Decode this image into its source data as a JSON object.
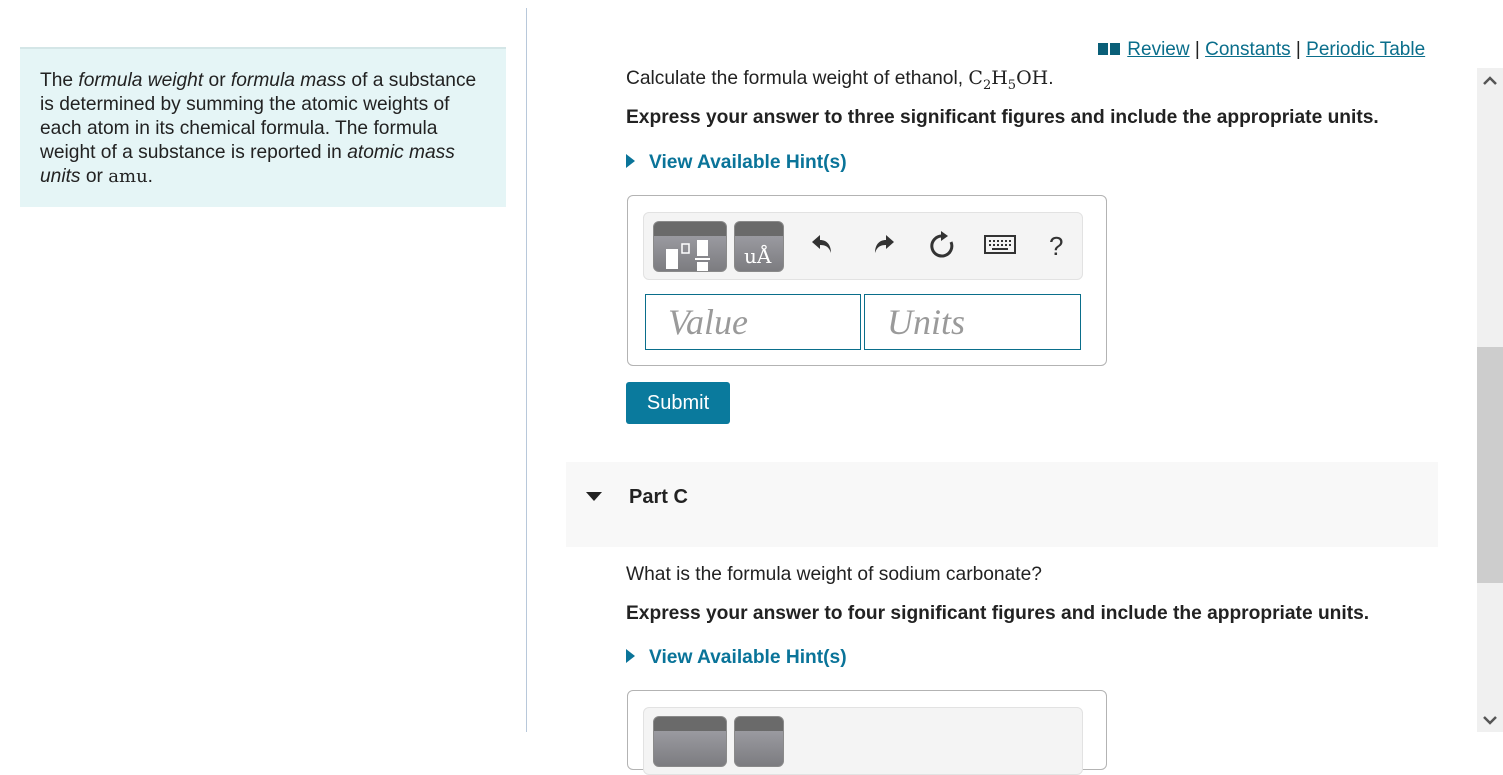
{
  "intro": {
    "segments": [
      {
        "text": "The ",
        "style": "normal"
      },
      {
        "text": "formula weight",
        "style": "italic"
      },
      {
        "text": " or ",
        "style": "normal"
      },
      {
        "text": "formula mass",
        "style": "italic"
      },
      {
        "text": " of a substance is determined by summing the atomic weights of each atom in its chemical formula. The formula weight of a substance is reported in ",
        "style": "normal"
      },
      {
        "text": "atomic mass units",
        "style": "italic"
      },
      {
        "text": " or ",
        "style": "normal"
      },
      {
        "text": "amu",
        "style": "math"
      },
      {
        "text": ".",
        "style": "normal"
      }
    ]
  },
  "top_links": {
    "icon": "book-icon",
    "review": "Review",
    "separator": "|",
    "constants": "Constants",
    "periodic_table": "Periodic Table"
  },
  "part_b": {
    "question_prefix": "Calculate the formula weight of ethanol, ",
    "formula": {
      "c": "C",
      "c_sub": "2",
      "h": "H",
      "h_sub": "5",
      "rest": "OH"
    },
    "question_suffix": ".",
    "instruction": "Express your answer to three significant figures and include the appropriate units.",
    "hint_label": "View Available Hint(s)",
    "toolbar": {
      "templates_icon": "templates-icon",
      "units_icon": "units-icon",
      "units_text": "uÅ",
      "undo_icon": "undo-icon",
      "redo_icon": "redo-icon",
      "reset_icon": "reset-icon",
      "keyboard_icon": "keyboard-icon",
      "help_label": "?"
    },
    "value_placeholder": "Value",
    "value": "",
    "units_placeholder": "Units",
    "units": "",
    "submit_label": "Submit"
  },
  "part_c": {
    "title": "Part C",
    "question": "What is the formula weight of sodium carbonate?",
    "instruction": "Express your answer to four significant figures and include the appropriate units.",
    "hint_label": "View Available Hint(s)"
  },
  "colors": {
    "accent": "#0a7499",
    "link": "#0a6e8b",
    "submit_bg": "#0a7a9d",
    "intro_bg": "#e5f5f6",
    "part_header_bg": "#f8f8f8"
  }
}
